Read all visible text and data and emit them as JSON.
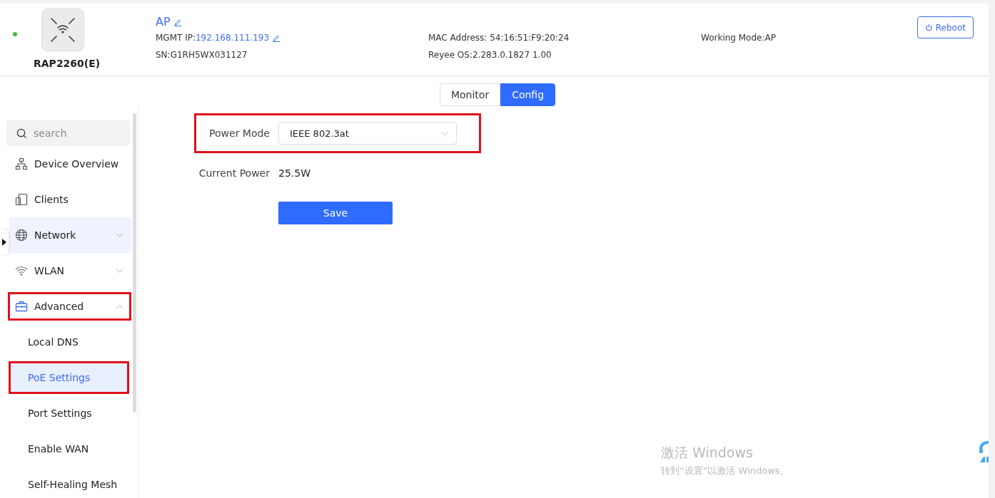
{
  "device": {
    "online": true,
    "model": "RAP2260(E)",
    "name": "AP",
    "mgmt_ip_label": "MGMT IP:",
    "mgmt_ip": "192.168.111.193",
    "sn": "SN:G1RH5WX031127",
    "mac": "MAC Address: 54:16:51:F9:20:24",
    "os": "Reyee OS:2.283.0.1827 1.00",
    "working_mode": "Working Mode:AP"
  },
  "reboot_button": "Reboot",
  "tabs": [
    {
      "label": "Monitor",
      "selected": false
    },
    {
      "label": "Config",
      "selected": true
    }
  ],
  "sidebar": {
    "search": {
      "placeholder": "search"
    },
    "items": [
      {
        "label": "Device Overview",
        "group": false,
        "tinted": false,
        "highlighted": false
      },
      {
        "label": "Clients",
        "group": false,
        "tinted": false,
        "highlighted": false
      },
      {
        "label": "Network",
        "group": true,
        "expanded": false,
        "tinted": true,
        "highlighted": false
      },
      {
        "label": "WLAN",
        "group": true,
        "expanded": false,
        "tinted": false,
        "highlighted": false
      },
      {
        "label": "Advanced",
        "group": true,
        "expanded": true,
        "tinted": false,
        "highlighted": true,
        "children": [
          {
            "label": "Local DNS",
            "selected": false,
            "highlighted": false
          },
          {
            "label": "PoE Settings",
            "selected": true,
            "highlighted": true
          },
          {
            "label": "Port Settings",
            "selected": false,
            "highlighted": false
          },
          {
            "label": "Enable WAN",
            "selected": false,
            "highlighted": false
          },
          {
            "label": "Self-Healing Mesh",
            "selected": false,
            "highlighted": false
          }
        ]
      }
    ]
  },
  "form": {
    "power_mode": {
      "label": "Power Mode",
      "value": "IEEE 802.3at",
      "highlighted": true
    },
    "current_power": {
      "label": "Current Power",
      "value": "25.5W"
    },
    "save_button": "Save"
  },
  "windows_activation": {
    "title": "激活 Windows",
    "message": "转到“设置”以激活 Windows。"
  }
}
